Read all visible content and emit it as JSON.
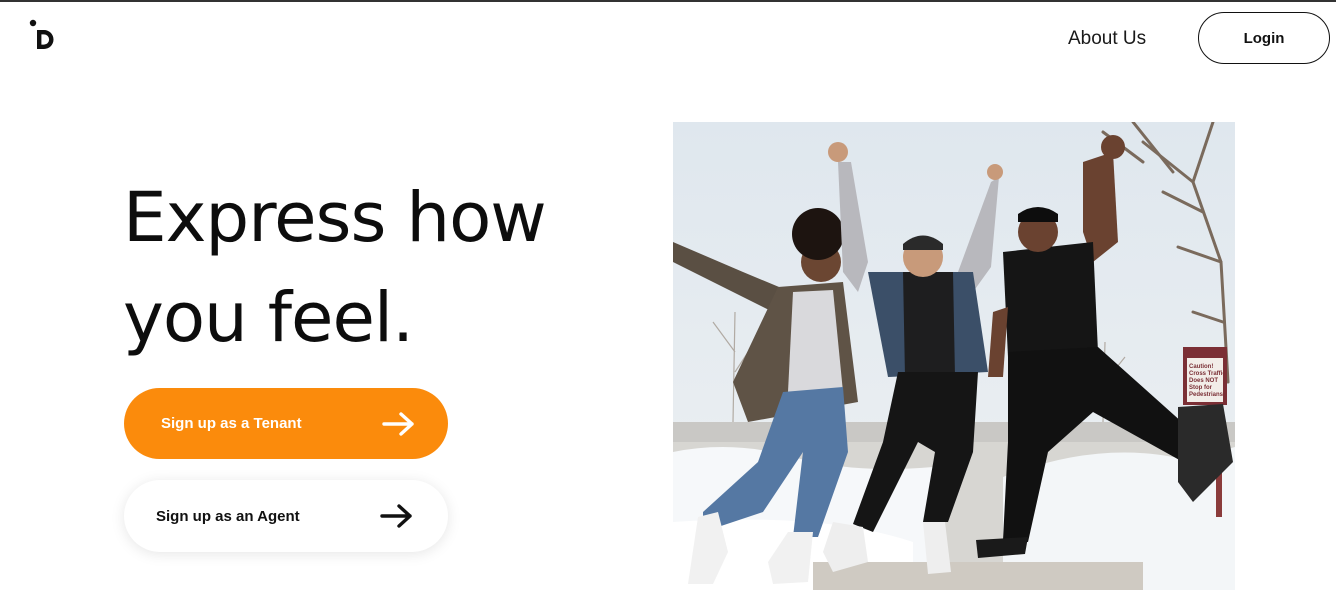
{
  "header": {
    "logo_icon": "logo-d-icon",
    "about_label": "About Us",
    "login_label": "Login"
  },
  "hero": {
    "headline_line1": "Express how",
    "headline_line2": "you feel.",
    "tenant_cta_label": "Sign up as a Tenant",
    "agent_cta_label": "Sign up as an Agent",
    "arrow_icon": "arrow-right-icon",
    "sign_lines": [
      "Caution!",
      "Cross Traffic",
      "Does NOT",
      "Stop for",
      "Pedestrians"
    ]
  },
  "colors": {
    "accent": "#fb8b0c",
    "text": "#111111",
    "background": "#ffffff"
  }
}
